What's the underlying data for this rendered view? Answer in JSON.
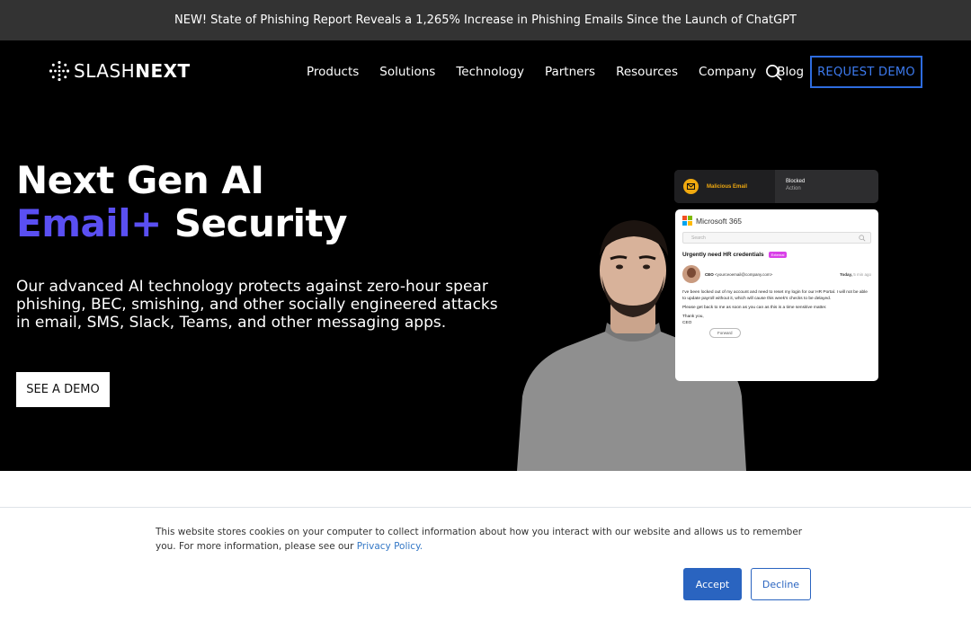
{
  "announcement": {
    "text": "NEW! State of Phishing Report Reveals a 1,265% Increase in Phishing Emails Since the Launch of ChatGPT"
  },
  "brand": {
    "slash": "SLASH",
    "next": "NEXT"
  },
  "nav": {
    "items": [
      "Products",
      "Solutions",
      "Technology",
      "Partners",
      "Resources",
      "Company",
      "Blog"
    ],
    "search_icon": "search-icon",
    "cta": "REQUEST DEMO"
  },
  "hero": {
    "title_line1": "Next Gen AI",
    "title_accent": "Email+",
    "title_line2_rest": " Security",
    "lead": "Our advanced AI technology protects against zero-hour spear phishing, BEC, smishing, and other socially engineered attacks in email, SMS, Slack, Teams, and other messaging apps.",
    "cta": "SEE A DEMO"
  },
  "alert_card": {
    "label": "Malicious Email",
    "status": "Blocked",
    "status_sub": "Action"
  },
  "email_card": {
    "app": "Microsoft 365",
    "search_placeholder": "Search",
    "subject": "Urgently need HR credentials",
    "tag": "External",
    "sender_name": "CEO",
    "sender_email": "<yourceoemail@company.com>",
    "date": "Today,",
    "date_ago": "5 min ago",
    "body_1": "I've been locked out of my account and need to reset my login for our HR Portal. I will not be able to update payroll without it, which will cause this week's checks to be delayed.",
    "body_2": "Please get back to me as soon as you can as this is a time sensitive matter.",
    "body_3": "Thank you,",
    "body_4": "CEO",
    "forward": "Forward"
  },
  "cookie": {
    "text": "This website stores cookies on your computer to collect information about how you interact with our website and allows us to remember you. For more information, please see our ",
    "link": "Privacy Policy.",
    "accept": "Accept",
    "decline": "Decline"
  },
  "colors": {
    "accent": "#5a4ff2",
    "demo_border": "#2e6cdf",
    "accept": "#2a64c0",
    "alert": "#f0a90f"
  }
}
